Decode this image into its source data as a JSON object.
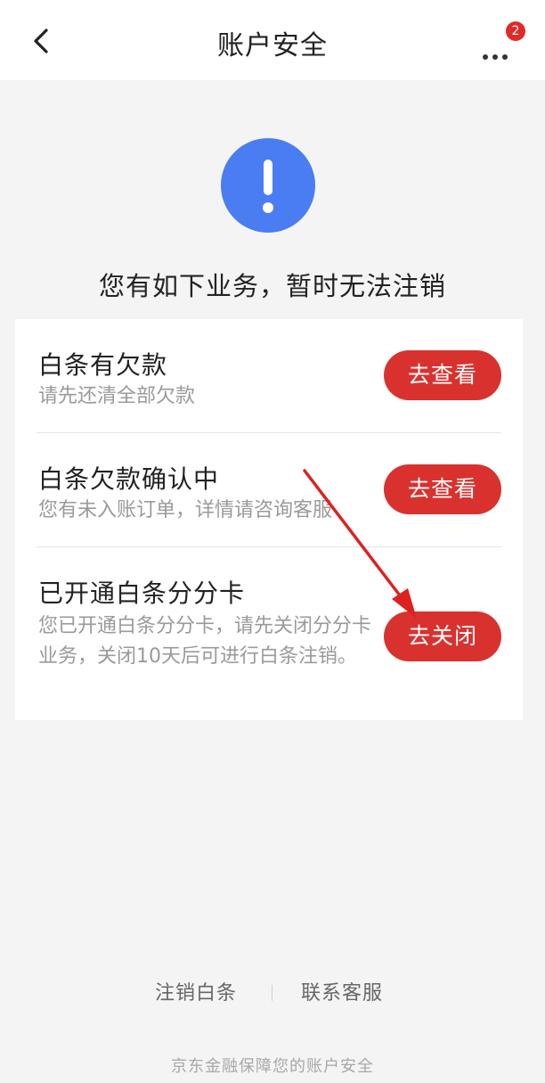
{
  "header": {
    "title": "账户安全",
    "back_icon": "chevron-left-icon",
    "more_icon": "more-dots-icon",
    "badge_count": "2"
  },
  "notice": {
    "icon": "exclamation-circle-icon",
    "icon_color": "#4a7df2",
    "text": "您有如下业务，暂时无法注销"
  },
  "items": [
    {
      "title": "白条有欠款",
      "desc": "请先还清全部欠款",
      "button": "去查看"
    },
    {
      "title": "白条欠款确认中",
      "desc": "您有未入账订单，详情请咨询客服",
      "button": "去查看"
    },
    {
      "title": "已开通白条分分卡",
      "desc": "您已开通白条分分卡，请先关闭分分卡业务，关闭10天后可进行白条注销。",
      "button": "去关闭"
    }
  ],
  "footer": {
    "link_cancel": "注销白条",
    "link_service": "联系客服",
    "note": "京东金融保障您的账户安全"
  },
  "colors": {
    "accent_red": "#d9322e",
    "badge_red": "#e02a2a",
    "annotation_arrow": "#e02020"
  }
}
